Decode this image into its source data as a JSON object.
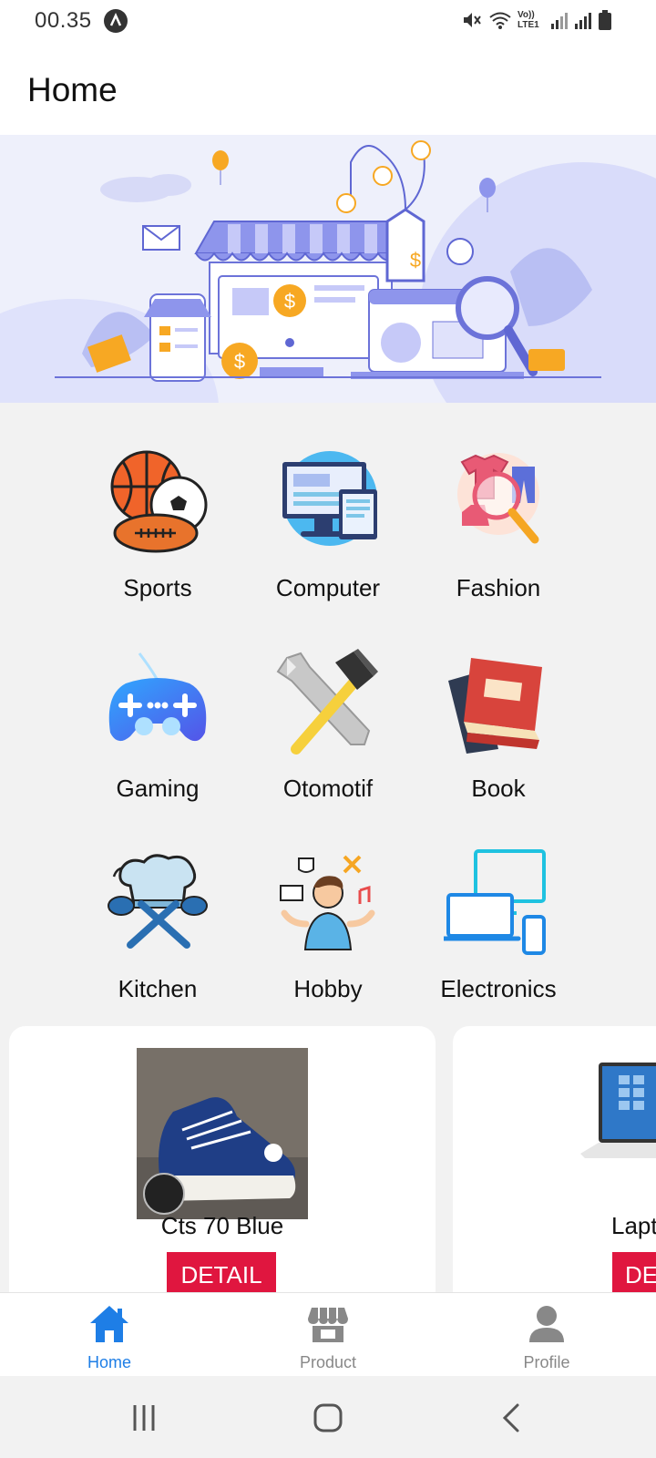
{
  "status": {
    "time": "00.35",
    "network": "Vo)) LTE1"
  },
  "header": {
    "title": "Home"
  },
  "categories": [
    {
      "label": "Sports",
      "icon": "sports-balls-icon"
    },
    {
      "label": "Computer",
      "icon": "computer-icon"
    },
    {
      "label": "Fashion",
      "icon": "fashion-icon"
    },
    {
      "label": "Gaming",
      "icon": "gamepad-icon"
    },
    {
      "label": "Otomotif",
      "icon": "wrench-hammer-icon"
    },
    {
      "label": "Book",
      "icon": "book-icon"
    },
    {
      "label": "Kitchen",
      "icon": "chef-hat-icon"
    },
    {
      "label": "Hobby",
      "icon": "hobby-person-icon"
    },
    {
      "label": "Electronics",
      "icon": "devices-icon"
    }
  ],
  "products": [
    {
      "name": "Cts 70 Blue",
      "button": "DETAIL"
    },
    {
      "name": "Lapt",
      "button": "DE"
    }
  ],
  "bottom_nav": {
    "items": [
      {
        "label": "Home",
        "icon": "home-icon",
        "active": true
      },
      {
        "label": "Product",
        "icon": "store-icon",
        "active": false
      },
      {
        "label": "Profile",
        "icon": "person-icon",
        "active": false
      }
    ]
  },
  "colors": {
    "accent": "#1e7ee6",
    "detail_button": "#e0163f",
    "banner_purple": "#7b82e8"
  }
}
